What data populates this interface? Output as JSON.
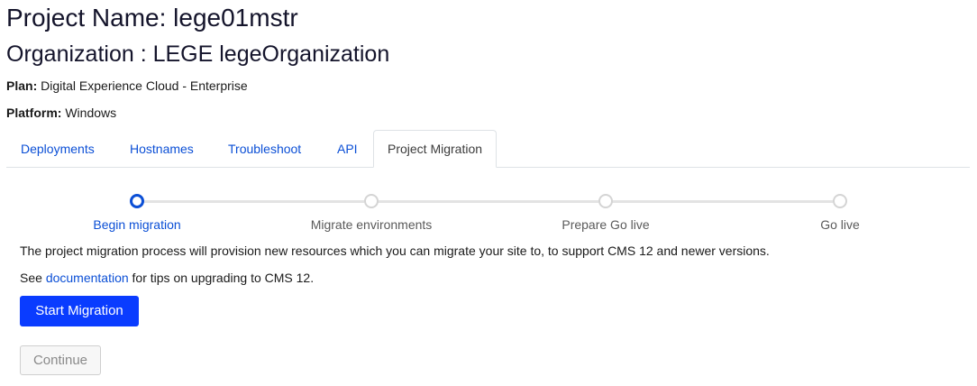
{
  "project": {
    "title": "Project Name: lege01mstr",
    "organization": "Organization : LEGE legeOrganization",
    "plan_label": "Plan:",
    "plan_value": "Digital Experience Cloud - Enterprise",
    "platform_label": "Platform:",
    "platform_value": "Windows"
  },
  "tabs": [
    {
      "label": "Deployments",
      "active": false
    },
    {
      "label": "Hostnames",
      "active": false
    },
    {
      "label": "Troubleshoot",
      "active": false
    },
    {
      "label": "API",
      "active": false
    },
    {
      "label": "Project Migration",
      "active": true
    }
  ],
  "stepper": {
    "current_step": 1,
    "steps": [
      {
        "label": "Begin migration"
      },
      {
        "label": "Migrate environments"
      },
      {
        "label": "Prepare Go live"
      },
      {
        "label": "Go live"
      }
    ]
  },
  "content": {
    "description": "The project migration process will provision new resources which you can migrate your site to, to support CMS 12 and newer versions.",
    "see_prefix": "See ",
    "doc_link": "documentation",
    "see_suffix": " for tips on upgrading to CMS 12."
  },
  "actions": {
    "start_label": "Start Migration",
    "continue_label": "Continue",
    "continue_disabled": true
  },
  "colors": {
    "accent": "#0b4fd6",
    "primary_button": "#0a3cff",
    "heading": "#14142b"
  }
}
